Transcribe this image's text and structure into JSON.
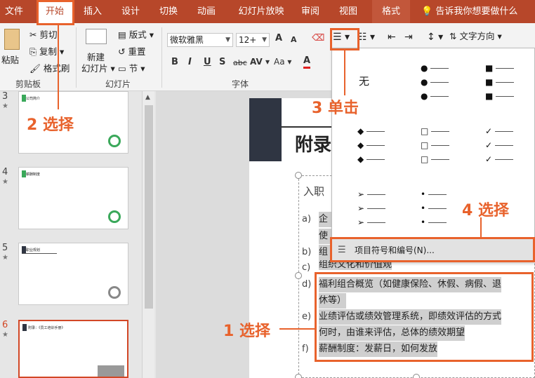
{
  "tabs": [
    "文件",
    "开始",
    "插入",
    "设计",
    "切换",
    "动画",
    "幻灯片放映",
    "审阅",
    "视图",
    "格式"
  ],
  "tellme": "告诉我你想要做什么",
  "clipboard": {
    "paste": "粘贴",
    "cut": "剪切",
    "copy": "复制",
    "format_painter": "格式刷",
    "group_label": "剪贴板"
  },
  "slides_group": {
    "new_slide_line1": "新建",
    "new_slide_line2": "幻灯片",
    "layout": "版式",
    "reset": "重置",
    "section": "节",
    "group_label": "幻灯片"
  },
  "font_group": {
    "font_name": "微软雅黑",
    "font_size": "12+",
    "bold": "B",
    "italic": "I",
    "underline": "U",
    "shadow": "S",
    "strike": "abc",
    "spacing": "AV",
    "case": "Aa",
    "color": "A",
    "grow": "A",
    "shrink": "A",
    "group_label": "字体"
  },
  "paragraph": {
    "text_direction": "文字方向"
  },
  "thumbnails": [
    {
      "num": "3",
      "title": "公司简介"
    },
    {
      "num": "4",
      "title": "薪酬制度"
    },
    {
      "num": "5",
      "title": "职业规划"
    },
    {
      "num": "6",
      "title": "附录：《员工培训手册》"
    }
  ],
  "slide": {
    "title": "附录",
    "subtitle": "入职",
    "items": [
      {
        "label": "a)",
        "text": "企"
      },
      {
        "label": "",
        "text": "使"
      },
      {
        "label": "b)",
        "text": "组"
      },
      {
        "label": "c)",
        "text": "组织文化和价值观"
      },
      {
        "label": "d)",
        "text": "福利组合概览（如健康保险、休假、病假、退"
      },
      {
        "label": "",
        "text": "休等）"
      },
      {
        "label": "e)",
        "text": "业绩评估或绩效管理系统，即绩效评估的方式"
      },
      {
        "label": "",
        "text": "何时，由谁来评估，总体的绩效期望"
      },
      {
        "label": "f)",
        "text": "薪酬制度：发薪日，如何发放"
      }
    ]
  },
  "bullet_gallery": {
    "none": "无",
    "sets": [
      {
        "glyph": "●"
      },
      {
        "glyph": "■"
      },
      {
        "glyph": "◆"
      },
      {
        "glyph": "□"
      },
      {
        "glyph": "✓"
      },
      {
        "glyph": "➢"
      },
      {
        "glyph": "•"
      }
    ],
    "menu_item": "项目符号和编号(N)..."
  },
  "annotations": {
    "step1": "1 选择",
    "step2": "2 选择",
    "step3": "3 单击",
    "step4": "4 选择"
  },
  "colors": {
    "ribbon_tab": "#b7472a",
    "annotation": "#e8622c"
  }
}
